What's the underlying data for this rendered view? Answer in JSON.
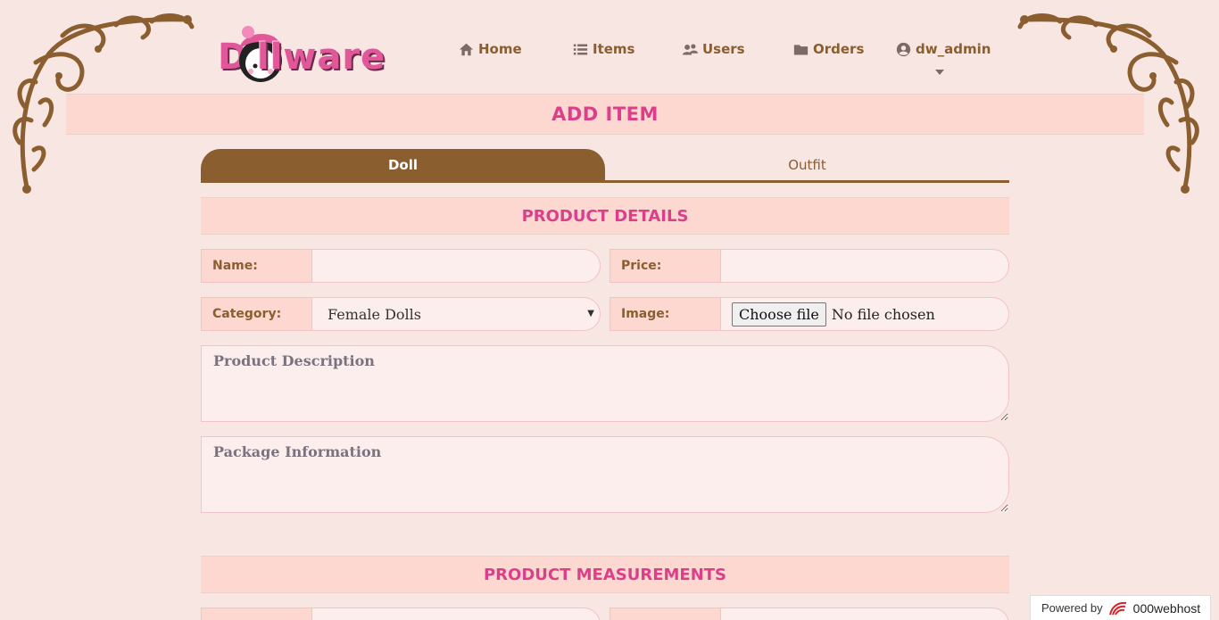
{
  "brand": {
    "logo_initial": "D",
    "logo_text": "llware"
  },
  "nav": {
    "home": "Home",
    "items": "Items",
    "users": "Users",
    "orders": "Orders",
    "account": "dw_admin"
  },
  "page": {
    "title": "ADD ITEM"
  },
  "tabs": [
    {
      "label": "Doll",
      "active": true
    },
    {
      "label": "Outfit",
      "active": false
    }
  ],
  "sections": {
    "details": "PRODUCT DETAILS",
    "measurements": "PRODUCT MEASUREMENTS"
  },
  "form": {
    "name_label": "Name:",
    "name_value": "",
    "price_label": "Price:",
    "price_value": "",
    "category_label": "Category:",
    "category_selected": "Female Dolls",
    "image_label": "Image:",
    "file_button": "Choose file",
    "file_status": "No file chosen",
    "description_placeholder": "Product Description",
    "package_placeholder": "Package Information"
  },
  "footer": {
    "powered_by": "Powered by",
    "host": "000webhost"
  },
  "colors": {
    "background": "#f8e6e3",
    "band": "#fdd8d0",
    "accent_pink": "#db3f8c",
    "brown": "#8b5e2f"
  }
}
